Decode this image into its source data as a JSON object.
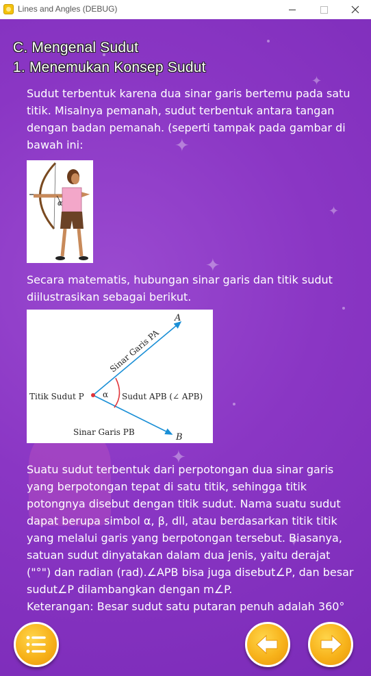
{
  "window": {
    "title": "Lines and Angles (DEBUG)"
  },
  "heading": {
    "line1": "C. Mengenal Sudut",
    "line2": "1. Menemukan Konsep Sudut"
  },
  "paragraphs": {
    "intro": "Sudut terbentuk karena dua sinar garis bertemu pada satu titik. Misalnya pemanah, sudut terbentuk antara tangan dengan badan pemanah. (seperti tampak pada gambar di bawah ini:",
    "math": "Secara matematis, hubungan sinar garis dan titik sudut diilustrasikan sebagai berikut.",
    "body": "Suatu sudut terbentuk dari perpotongan dua sinar garis yang berpotongan tepat di satu titik, sehingga titik potongnya disebut dengan titik sudut. Nama suatu sudut dapat berupa simbol α, β, dll, atau berdasarkan titik titik yang melalui garis yang berpotongan tersebut. Biasanya, satuan sudut dinyatakan dalam dua jenis, yaitu derajat (\"°\") dan radian (rad).∠APB bisa juga disebut∠P, dan besar sudut∠P dilambangkan dengan m∠P.",
    "note": "Keterangan: Besar sudut satu putaran penuh adalah 360°"
  },
  "archer": {
    "alpha": "α"
  },
  "diagram": {
    "label_a": "A",
    "label_b": "B",
    "ray_pa": "Sinar Garis PA",
    "ray_pb": "Sinar Garis PB",
    "vertex": "Titik Sudut P",
    "alpha": "α",
    "angle": "Sudut APB (∠ APB)"
  },
  "nav": {
    "menu_icon": "list-icon",
    "prev_icon": "arrow-left-icon",
    "next_icon": "arrow-right-icon"
  },
  "colors": {
    "background": "#8a36c4",
    "button": "#f7b21a",
    "ray": "#1a8fd6",
    "arc": "#e0343a"
  }
}
